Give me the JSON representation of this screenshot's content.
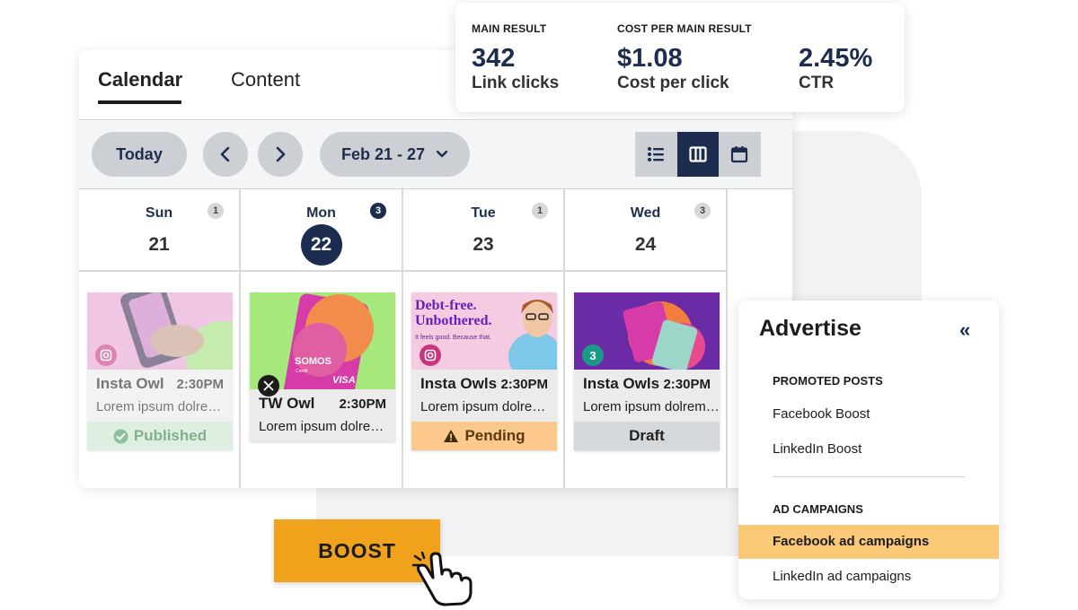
{
  "tabs": {
    "calendar": "Calendar",
    "content": "Content"
  },
  "toolbar": {
    "today": "Today",
    "range": "Feb 21 - 27"
  },
  "metrics": [
    {
      "label": "MAIN RESULT",
      "value": "342",
      "sub": "Link clicks"
    },
    {
      "label": "COST PER MAIN RESULT",
      "value": "$1.08",
      "sub": "Cost per click"
    },
    {
      "label": "",
      "value": "2.45%",
      "sub": "CTR"
    }
  ],
  "days": [
    {
      "dow": "Sun",
      "date": "21",
      "count": "1"
    },
    {
      "dow": "Mon",
      "date": "22",
      "count": "3"
    },
    {
      "dow": "Tue",
      "date": "23",
      "count": "1"
    },
    {
      "dow": "Wed",
      "date": "24",
      "count": "3"
    }
  ],
  "posts": [
    {
      "name": "Insta Owl",
      "time": "2:30PM",
      "desc": "Lorem ipsum dolre…",
      "status": "Published",
      "network": "instagram"
    },
    {
      "name": "TW Owl",
      "time": "2:30PM",
      "desc": "Lorem ipsum dolre…",
      "network": "x"
    },
    {
      "name": "Insta Owls",
      "time": "2:30PM",
      "desc": "Lorem ipsum dolre…",
      "status": "Pending",
      "network": "instagram",
      "headline": "Debt-free. Unbothered.",
      "tagline": "It feels good. Because that."
    },
    {
      "name": "Insta Owls",
      "time": "2:30PM",
      "desc": "Lorem ipsum dolrem…",
      "status": "Draft",
      "network": "group",
      "network_count": "3"
    }
  ],
  "card_brand": "SOMOS",
  "card_sub": "Credit",
  "card_visa": "VISA",
  "advertise": {
    "title": "Advertise",
    "collapse": "«",
    "promoted_title": "PROMOTED POSTS",
    "promoted": [
      "Facebook Boost",
      "LinkedIn Boost"
    ],
    "campaigns_title": "AD CAMPAIGNS",
    "campaigns": [
      "Facebook ad campaigns",
      "LinkedIn ad campaigns"
    ]
  },
  "boost": "BOOST",
  "colors": {
    "navy": "#1b2c4f",
    "orange": "#f0a21c",
    "highlight": "#fac978",
    "published": "#3a9a57",
    "pending": "#fcc98c"
  }
}
